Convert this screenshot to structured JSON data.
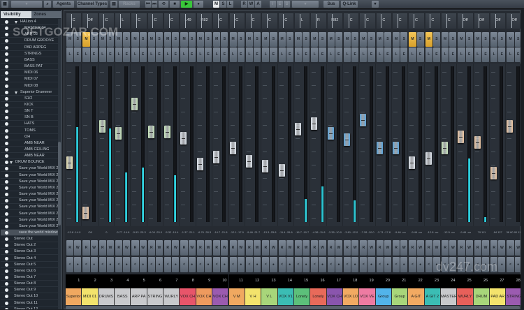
{
  "toolbar": {
    "agents": "Agents",
    "channel_types": "Channel Types",
    "racks": "Racks",
    "msl": [
      "M",
      "S",
      "L"
    ],
    "rwa": [
      "R",
      "W",
      "A"
    ],
    "ies": [
      "I",
      "E",
      "S"
    ],
    "sus_abs": "Sus Abs",
    "q_link": "Q-Link",
    "transport_icons": [
      "rewind-icon",
      "forward-icon",
      "cycle-icon",
      "stop-icon",
      "play-icon",
      "record-icon"
    ]
  },
  "left_panel": {
    "tabs": [
      "Visibility",
      "Zones"
    ],
    "active_tab": "Visibility",
    "items": [
      {
        "label": "HALion 4",
        "level": 1,
        "folder": true
      },
      {
        "label": "MASTER 04",
        "level": 2
      },
      {
        "label": "ARP 03",
        "level": 2
      },
      {
        "label": "DRUM GROOVE",
        "level": 2
      },
      {
        "label": "PAD ARPEG",
        "level": 2
      },
      {
        "label": "STRINGS",
        "level": 2
      },
      {
        "label": "BASS",
        "level": 2
      },
      {
        "label": "BASS PAT",
        "level": 2
      },
      {
        "label": "MIDI 06",
        "level": 2
      },
      {
        "label": "MIDI 07",
        "level": 2
      },
      {
        "label": "MIDI 08",
        "level": 2
      },
      {
        "label": "Superior Drummer",
        "level": 1,
        "folder": true
      },
      {
        "label": "S1/2",
        "level": 2
      },
      {
        "label": "KICK",
        "level": 2
      },
      {
        "label": "SN T",
        "level": 2
      },
      {
        "label": "SN B",
        "level": 2
      },
      {
        "label": "HATS",
        "level": 2
      },
      {
        "label": "TOMS",
        "level": 2
      },
      {
        "label": "OH",
        "level": 2
      },
      {
        "label": "AMB NEAR",
        "level": 2
      },
      {
        "label": "AMB CEILING",
        "level": 2
      },
      {
        "label": "AMB NEAR",
        "level": 2
      },
      {
        "label": "DRUM BOUNCE",
        "level": 0,
        "folder": true
      },
      {
        "label": "Save your World MIX 2",
        "level": 1
      },
      {
        "label": "Save your World MIX 2",
        "level": 1
      },
      {
        "label": "Save your World MIX 2",
        "level": 1
      },
      {
        "label": "Save your World MIX 2",
        "level": 1
      },
      {
        "label": "Save your World MIX 2",
        "level": 1
      },
      {
        "label": "Save your World MIX 2",
        "level": 1
      },
      {
        "label": "Save your World MIX 2",
        "level": 1
      },
      {
        "label": "Save your World MIX 2",
        "level": 1
      },
      {
        "label": "Save your World MIX 2",
        "level": 1
      },
      {
        "label": "Save your World MIX 2",
        "level": 1
      },
      {
        "label": "save the world mixdown",
        "level": 1,
        "selected": true
      },
      {
        "label": "Stereo Out",
        "level": 0
      },
      {
        "label": "Stereo Out 2",
        "level": 0
      },
      {
        "label": "Stereo Out 3",
        "level": 0
      },
      {
        "label": "Stereo Out 4",
        "level": 0
      },
      {
        "label": "Stereo Out 5",
        "level": 0
      },
      {
        "label": "Stereo Out 6",
        "level": 0
      },
      {
        "label": "Stereo Out 7",
        "level": 0
      },
      {
        "label": "Stereo Out 8",
        "level": 0
      },
      {
        "label": "Stereo Out 9",
        "level": 0
      },
      {
        "label": "Stereo Out 10",
        "level": 0
      },
      {
        "label": "Stereo Out 11",
        "level": 0
      },
      {
        "label": "Stereo Out 12",
        "level": 0
      }
    ]
  },
  "mixer": {
    "button_labels": {
      "mute": "M",
      "solo": "S",
      "listen": "L",
      "edit": "E",
      "read": "R",
      "write": "W",
      "monitor": "<",
      "record": "●"
    },
    "colors": {
      "mute_on": "#f2c14e",
      "meter": "#2fd3df"
    },
    "channels": [
      {
        "num": "1",
        "name": "Superior",
        "color": "#f0a860",
        "pan": "C",
        "readout": "-13.8 -14.0",
        "fader": 0.37,
        "meter": 0.61,
        "cap": "#efe9b8",
        "mute": false
      },
      {
        "num": "2",
        "name": "MIDI 01",
        "color": "#f3e36c",
        "pan": "Off",
        "readout": "Off",
        "fader": 0.03,
        "meter": 0,
        "cap": "#f2c9a3",
        "mute": true
      },
      {
        "num": "3",
        "name": "DRUMS",
        "color": "#c8c9cc",
        "pan": "C",
        "readout": "0",
        "fader": 0.62,
        "meter": 0.6,
        "cap": "#cdebc0",
        "mute": false
      },
      {
        "num": "4",
        "name": "BASS",
        "color": "#c8c9cc",
        "pan": "L",
        "readout": "-3.77 -14.8",
        "fader": 0.57,
        "meter": 0.32,
        "cap": "#cdebc0",
        "mute": false
      },
      {
        "num": "5",
        "name": "ARP PA",
        "color": "#c8c9cc",
        "pan": "C",
        "readout": "-5.93 -25.3",
        "fader": 0.77,
        "meter": 0.35,
        "cap": "#cdebc0",
        "mute": false
      },
      {
        "num": "6",
        "name": "STRING",
        "color": "#c8c9cc",
        "pan": "C",
        "readout": "-6.09 -25.0",
        "fader": 0.58,
        "meter": 0,
        "cap": "#cdebc0",
        "mute": false
      },
      {
        "num": "7",
        "name": "WURLY",
        "color": "#c8c9cc",
        "pan": "C",
        "readout": "-5.32 -19.4",
        "fader": 0.58,
        "meter": 0.3,
        "cap": "#cdebc0",
        "mute": false
      },
      {
        "num": "8",
        "name": "VOX CH",
        "color": "#e8556a",
        "pan": "L49",
        "readout": "-1.37 -21.1",
        "fader": 0.54,
        "meter": 0,
        "cap": "#e2e8f0",
        "mute": false
      },
      {
        "num": "9",
        "name": "VOX CH",
        "color": "#ee9a5e",
        "pan": "R82",
        "readout": "-6.76 -30.3",
        "fader": 0.36,
        "meter": 0,
        "cap": "#e2e8f0",
        "mute": false
      },
      {
        "num": "10",
        "name": "VOX CH",
        "color": "#9b5bb0",
        "pan": "C",
        "readout": "-14.7 -21.8",
        "fader": 0.41,
        "meter": 0,
        "cap": "#e2e8f0",
        "mute": false
      },
      {
        "num": "11",
        "name": "V M",
        "color": "#f0a860",
        "pan": "C",
        "readout": "-12.1 -17.9",
        "fader": 0.47,
        "meter": 0,
        "cap": "#e2e8f0",
        "mute": false
      },
      {
        "num": "12",
        "name": "V H",
        "color": "#f3e36c",
        "pan": "C",
        "readout": "-9.46 -21.7",
        "fader": 0.38,
        "meter": 0,
        "cap": "#e2e8f0",
        "mute": false
      },
      {
        "num": "13",
        "name": "V L",
        "color": "#a8d67a",
        "pan": "C",
        "readout": "-13.3 -25.8",
        "fader": 0.35,
        "meter": 0,
        "cap": "#e2e8f0",
        "mute": false
      },
      {
        "num": "14",
        "name": "VOX V1",
        "color": "#3bbdb4",
        "pan": "C",
        "readout": "-11.4 -26.6",
        "fader": 0.32,
        "meter": 0,
        "cap": "#e2e8f0",
        "mute": false
      },
      {
        "num": "15",
        "name": "Lonely",
        "color": "#5cc07a",
        "pan": "L",
        "readout": "-16.7 -19.7",
        "fader": 0.6,
        "meter": 0.15,
        "cap": "#e2e8f0",
        "mute": false
      },
      {
        "num": "16",
        "name": "Lonely",
        "color": "#e86a5a",
        "pan": "R",
        "readout": "-4.38 -11.8",
        "fader": 0.64,
        "meter": 0.23,
        "cap": "#e2e8f0",
        "mute": false
      },
      {
        "num": "17",
        "name": "VOX CH",
        "color": "#8a55ad",
        "pan": "R82",
        "readout": "-3.35 -10.0",
        "fader": 0.57,
        "meter": 0,
        "cap": "#5aa7e0",
        "mute": false
      },
      {
        "num": "18",
        "name": "VOX LO",
        "color": "#f2aa62",
        "pan": "C",
        "readout": "-3.81 -12.0",
        "fader": 0.53,
        "meter": 0.14,
        "cap": "#5aa7e0",
        "mute": false
      },
      {
        "num": "19",
        "name": "VOX VE",
        "color": "#ee7ba2",
        "pan": "C",
        "readout": "-7.28 -10.0",
        "fader": 0.66,
        "meter": 0,
        "cap": "#5aa7e0",
        "mute": false
      },
      {
        "num": "20",
        "name": "Group",
        "color": "#52b4ea",
        "pan": "C",
        "readout": "-3.71 -17.8",
        "fader": 0.47,
        "meter": 0,
        "cap": "#5aa7e0",
        "mute": false
      },
      {
        "num": "21",
        "name": "Group",
        "color": "#a8d67a",
        "pan": "C",
        "readout": "-9.46 -oo",
        "fader": 0.47,
        "meter": 0,
        "cap": "#5aa7e0",
        "mute": false
      },
      {
        "num": "22",
        "name": "A GIT",
        "color": "#f2aa62",
        "pan": "C",
        "readout": "-9.46 -oo",
        "fader": 0.37,
        "meter": 0,
        "cap": "#e2e8f0",
        "mute": true
      },
      {
        "num": "23",
        "name": "A GIT 2",
        "color": "#3bbdb4",
        "pan": "C",
        "readout": "-12.8 -oo",
        "fader": 0.4,
        "meter": 0,
        "cap": "#e2e8f0",
        "mute": true
      },
      {
        "num": "24",
        "name": "MASTER",
        "color": "#c8c9cc",
        "pan": "C",
        "readout": "-12.5 -oo",
        "fader": 0.47,
        "meter": 0,
        "cap": "#cdebc0",
        "mute": false
      },
      {
        "num": "25",
        "name": "WURLY",
        "color": "#e8605a",
        "pan": "Off",
        "readout": "-9.46 -oo",
        "fader": 0.55,
        "meter": 0.41,
        "cap": "#f2c9a3",
        "mute": false
      },
      {
        "num": "26",
        "name": "DRUM",
        "color": "#a8d67a",
        "pan": "Off",
        "readout": "79 111",
        "fader": 0.51,
        "meter": 0.03,
        "cap": "#f2c9a3",
        "mute": false
      },
      {
        "num": "27",
        "name": "PAD AR",
        "color": "#f3e36c",
        "pan": "Off",
        "readout": "84 127",
        "fader": 0.3,
        "meter": 0,
        "cap": "#f2c9a3",
        "mute": false
      },
      {
        "num": "28",
        "name": "STRING",
        "color": "#9b5bb0",
        "pan": "Off",
        "readout": "38 80 90 114",
        "fader": 0.62,
        "meter": 0,
        "cap": "#f2c9a3",
        "mute": false
      }
    ]
  },
  "watermarks": [
    "SOFTGOZAR.COM",
    "dv247.com"
  ]
}
